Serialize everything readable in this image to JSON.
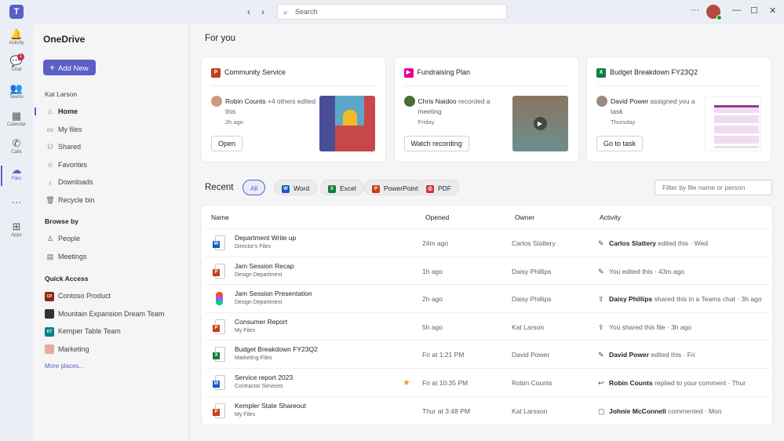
{
  "topbar": {
    "search_placeholder": "Search",
    "back": "‹",
    "forward": "›",
    "more": "···"
  },
  "rail": [
    {
      "label": "Activity",
      "icon": "🔔"
    },
    {
      "label": "Chat",
      "icon": "💬",
      "badge": "1"
    },
    {
      "label": "Teams",
      "icon": "👥"
    },
    {
      "label": "Calendar",
      "icon": "▦"
    },
    {
      "label": "Calls",
      "icon": "✆"
    },
    {
      "label": "Files",
      "icon": "☁"
    },
    {
      "label": "",
      "icon": "···"
    },
    {
      "label": "Apps",
      "icon": "⊞"
    }
  ],
  "sidebar": {
    "title": "OneDrive",
    "add_new": "Add New",
    "user": "Kat Larson",
    "items": [
      {
        "label": "Home",
        "icon": "⌂"
      },
      {
        "label": "My files",
        "icon": "▭"
      },
      {
        "label": "Shared",
        "icon": "⚇"
      },
      {
        "label": "Favorites",
        "icon": "☆"
      },
      {
        "label": "Downloads",
        "icon": "↓"
      },
      {
        "label": "Recycle bin",
        "icon": "🗑"
      }
    ],
    "browse_title": "Browse by",
    "browse": [
      {
        "label": "People",
        "icon": "♙"
      },
      {
        "label": "Meetings",
        "icon": "▤"
      }
    ],
    "quick_title": "Quick Access",
    "quick": [
      {
        "label": "Contoso Product",
        "abbr": "CP",
        "color": "#8a2a0e"
      },
      {
        "label": "Mountain Expansion Dream Team",
        "abbr": "",
        "color": "#333333"
      },
      {
        "label": "Kemper Table Team",
        "abbr": "KT",
        "color": "#038387"
      },
      {
        "label": "Marketing",
        "abbr": "",
        "color": "#e8a9a0"
      }
    ],
    "more": "More places..."
  },
  "main": {
    "title": "For you",
    "cards": [
      {
        "title": "Community Service",
        "app": "P",
        "color": "#c43e1c",
        "person": "Robin Counts",
        "action": " +4 others edited this",
        "when": "2h ago",
        "button": "Open"
      },
      {
        "title": "Fundraising Plan",
        "app": "▶",
        "color": "#e3008c",
        "person": "Chris Naidoo",
        "action": " recorded a meeting",
        "when": "Friday",
        "button": "Watch recording"
      },
      {
        "title": "Budget Breakdown FY23Q2",
        "app": "X",
        "color": "#107c41",
        "person": "David Power",
        "action": " assigned you a task",
        "when": "Thursday",
        "button": "Go to task"
      }
    ],
    "recent_title": "Recent",
    "filters": [
      "All",
      "Word",
      "Excel",
      "PowerPoint",
      "PDF"
    ],
    "filter_placeholder": "Filter by file name or person",
    "columns": [
      "Name",
      "Opened",
      "Owner",
      "Activity"
    ],
    "rows": [
      {
        "name": "Department Write up",
        "location": "Director's Files",
        "type": "W",
        "opened": "24m ago",
        "owner": "Carlos Slattery",
        "icon": "✎",
        "actor": "Carlos Slattery",
        "activity": " edited this · Wed"
      },
      {
        "name": "Jam Session Recap",
        "location": "Design Department",
        "type": "P",
        "opened": "1h ago",
        "owner": "Daisy Phillips",
        "icon": "✎",
        "actor": "",
        "activity": "You edited this · 43m ago"
      },
      {
        "name": "Jam Session Presentation",
        "location": "Design Department",
        "type": "F",
        "opened": "2h ago",
        "owner": "Daisy Phillips",
        "icon": "⇪",
        "actor": "Daisy Phillips",
        "activity": " shared this in a Teams chat · 3h ago"
      },
      {
        "name": "Consumer Report",
        "location": "My Files",
        "type": "P",
        "opened": "5h ago",
        "owner": "Kat Larson",
        "icon": "⇪",
        "actor": "",
        "activity": "You shared this file · 3h ago"
      },
      {
        "name": "Budget Breakdown FY23Q2",
        "location": "Marketing Files",
        "type": "X",
        "opened": "Fri at 1:21 PM",
        "owner": "David Power",
        "icon": "✎",
        "actor": "David Power",
        "activity": " edited this · Fri"
      },
      {
        "name": "Service report 2023",
        "location": "Contractor Services",
        "type": "W",
        "opened": "Fri at 10:35 PM",
        "owner": "Robin Counts",
        "icon": "↩",
        "actor": "Robin Counts",
        "activity": " replied to your comment · Thur",
        "starred": true
      },
      {
        "name": "Kempler State Shareout",
        "location": "My Files",
        "type": "P",
        "opened": "Thur at 3:48 PM",
        "owner": "Kat Larsson",
        "icon": "▢",
        "actor": "Johnie McConnell",
        "activity": " commented · Mon"
      }
    ]
  }
}
